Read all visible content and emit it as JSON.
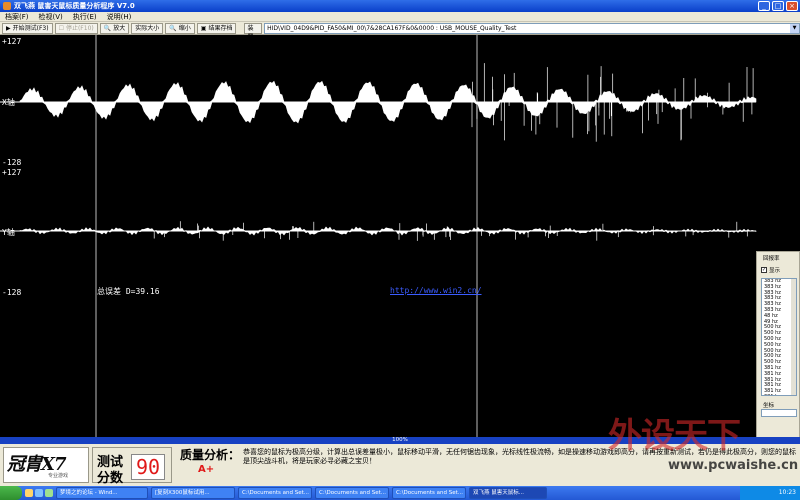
{
  "window": {
    "title": "双飞燕 鼠害天鼠标质量分析程序 V7.0",
    "controls": [
      "_",
      "□",
      "×"
    ]
  },
  "menu": [
    "档案(F)",
    "检视(V)",
    "执行(E)",
    "说明(H)"
  ],
  "toolbar": {
    "start": "开始测试(F3)",
    "stop": "停止(F10)",
    "zoom_in": "放大",
    "actual_size": "实际大小",
    "zoom_out": "缩小",
    "save_result": "结果存档",
    "device_label": "装置",
    "device_value": "HID\\VID_04D9&PID_FA50&MI_00\\7&28CA167F&0&0000 : USB_MOUSE_Quality_Test"
  },
  "plot": {
    "x_axis": {
      "label": "X轴",
      "max": "+127",
      "min": "-128"
    },
    "y_axis": {
      "label": "Y轴",
      "max": "+127",
      "min": "-128"
    },
    "total_error": "总误差 D=39.16",
    "link": "http://www.win2.cn/"
  },
  "rate_panel": {
    "title": "回报率",
    "show_label": "显示",
    "show_checked": true,
    "rates": [
      "383 hz",
      "383 hz",
      "383 hz",
      "383 hz",
      "383 hz",
      "383 hz",
      "48 hz",
      "49 hz",
      "500 hz",
      "500 hz",
      "500 hz",
      "500 hz",
      "500 hz",
      "500 hz",
      "500 hz",
      "381 hz",
      "381 hz",
      "381 hz",
      "381 hz",
      "381 hz",
      "381 hz"
    ],
    "coord_label": "坐标"
  },
  "progress": {
    "percent": 100,
    "text": "100%"
  },
  "result": {
    "brand": "冠胄X7",
    "brand_sub": "专业游戏",
    "score_label_1": "测试",
    "score_label_2": "分数",
    "score": "90",
    "analysis_title": "质量分析：",
    "grade": "A+",
    "analysis": "恭喜您的鼠标为极高分级，计算出总误差量极小，鼠标移动平滑，无任何锯齿现象，光标线性极流畅，如是操速移动游戏即高分，请再按重新测试，若仍是得此极高分，则您的鼠标是顶尖战斗机，将是玩家必寻必藏之宝贝！"
  },
  "watermark": {
    "cn": "外设天下",
    "url": "www.pcwaishe.cn"
  },
  "taskbar": {
    "tasks": [
      "梦境之的论坛 - Wind...",
      "[复刻X300鼠标试用...",
      "C:\\Documents and Set...",
      "C:\\Documents and Set...",
      "C:\\Documents and Set...",
      "双飞燕 鼠害天鼠标..."
    ],
    "active_index": 5,
    "clock": "10:23"
  },
  "colors": {
    "title_bar": "#0a3fc9",
    "progress": "#1741c2",
    "score": "#e01818",
    "link": "#3b5cff",
    "waveform": "#ffffff",
    "background": "#000000"
  }
}
